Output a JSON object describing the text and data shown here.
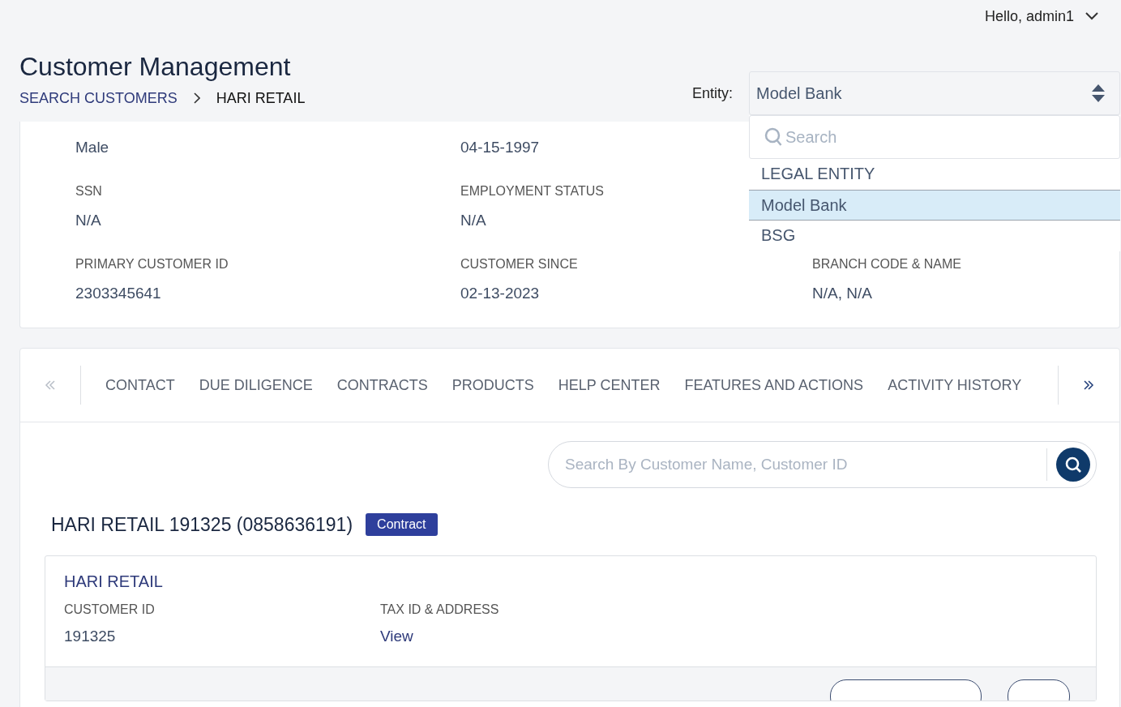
{
  "user": {
    "greeting": "Hello, admin1"
  },
  "page": {
    "title": "Customer Management",
    "breadcrumb": [
      {
        "label": "SEARCH CUSTOMERS",
        "current": false
      },
      {
        "label": "HARI RETAIL",
        "current": true
      }
    ]
  },
  "entity": {
    "label": "Entity:",
    "value": "Model Bank",
    "expanded": true,
    "search_placeholder": "Search",
    "options": [
      {
        "label": "LEGAL ENTITY",
        "selected": false
      },
      {
        "label": "Model Bank",
        "selected": true
      },
      {
        "label": "BSG",
        "selected": false
      }
    ]
  },
  "profile": {
    "rows": [
      [
        {
          "value": "Male"
        },
        {
          "value": "04-15-1997"
        }
      ],
      [
        {
          "label": "SSN",
          "value": "N/A"
        },
        {
          "label": "EMPLOYMENT STATUS",
          "value": "N/A"
        }
      ],
      [
        {
          "label": "PRIMARY CUSTOMER ID",
          "value": "2303345641"
        },
        {
          "label": "CUSTOMER SINCE",
          "value": "02-13-2023"
        },
        {
          "label": "BRANCH CODE & NAME",
          "value": "N/A, N/A"
        }
      ]
    ]
  },
  "tabs": {
    "prev_disabled": true,
    "next_disabled": false,
    "items": [
      {
        "label": "CONTACT"
      },
      {
        "label": "DUE DILIGENCE"
      },
      {
        "label": "CONTRACTS"
      },
      {
        "label": "PRODUCTS"
      },
      {
        "label": "HELP CENTER"
      },
      {
        "label": "FEATURES AND ACTIONS"
      },
      {
        "label": "ACTIVITY HISTORY"
      }
    ]
  },
  "search": {
    "placeholder": "Search By Customer Name, Customer ID"
  },
  "contract": {
    "title": "HARI RETAIL 191325 (0858636191)",
    "badge": "Contract",
    "name": "HARI RETAIL",
    "fields": [
      {
        "label": "CUSTOMER ID",
        "value": "191325",
        "kind": "text"
      },
      {
        "label": "TAX ID & ADDRESS",
        "value": "View",
        "kind": "link"
      }
    ]
  }
}
